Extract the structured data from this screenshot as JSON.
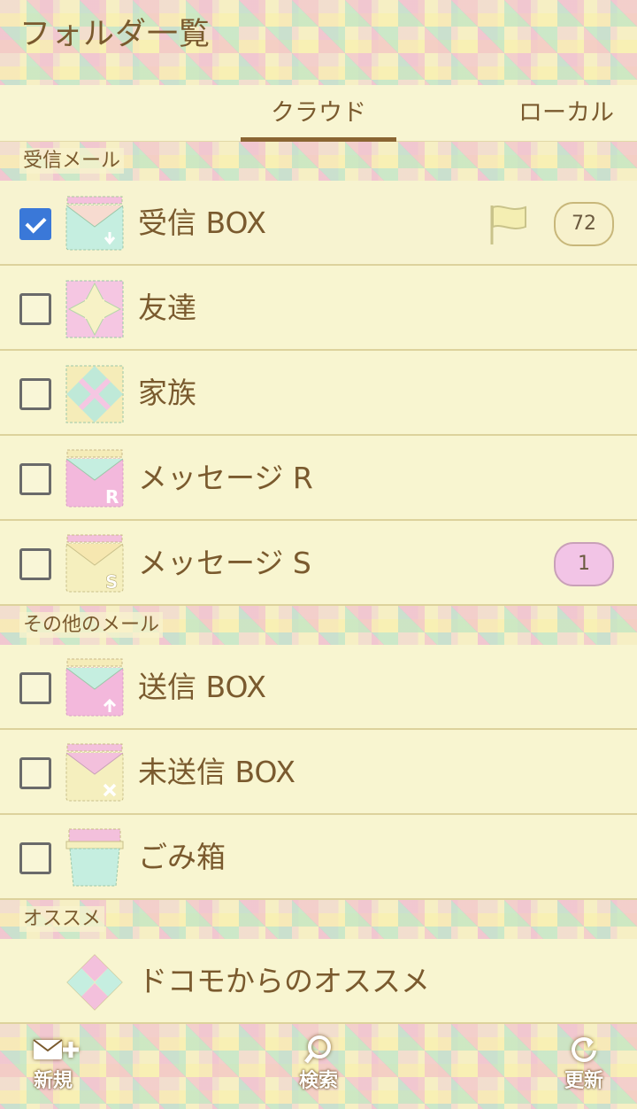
{
  "header": {
    "title": "フォルダ一覧"
  },
  "tabs": [
    {
      "label": "クラウド",
      "selected": true
    },
    {
      "label": "ローカル",
      "selected": false
    }
  ],
  "sections": {
    "inbox": {
      "label": "受信メール"
    },
    "other": {
      "label": "その他のメール"
    },
    "recommend": {
      "label": "オススメ"
    }
  },
  "folders": [
    {
      "label": "受信 BOX",
      "checked": true,
      "flag": true,
      "count": "72",
      "icon": "envelope-download-icon"
    },
    {
      "label": "友達",
      "checked": false,
      "count": "",
      "icon": "quilt-star-icon"
    },
    {
      "label": "家族",
      "checked": false,
      "count": "",
      "icon": "quilt-diamond-icon"
    },
    {
      "label": "メッセージ R",
      "checked": false,
      "count": "",
      "icon": "envelope-r-icon"
    },
    {
      "label": "メッセージ S",
      "checked": false,
      "count": "1",
      "icon": "envelope-s-icon"
    },
    {
      "label": "送信 BOX",
      "checked": false,
      "count": "",
      "icon": "envelope-upload-icon"
    },
    {
      "label": "未送信 BOX",
      "checked": false,
      "count": "",
      "icon": "envelope-x-icon"
    },
    {
      "label": "ごみ箱",
      "checked": false,
      "count": "",
      "icon": "trash-icon"
    }
  ],
  "recommend_item": {
    "label": "ドコモからのオススメ",
    "icon": "diamond-quilt-icon"
  },
  "footer": {
    "new_label": "新規",
    "search_label": "検索",
    "refresh_label": "更新"
  },
  "colors": {
    "text": "#7a5a2e",
    "checkbox_checked": "#3a78d8",
    "row_bg": "#f8f5d0",
    "badge_pink": "#f2c4e6"
  }
}
